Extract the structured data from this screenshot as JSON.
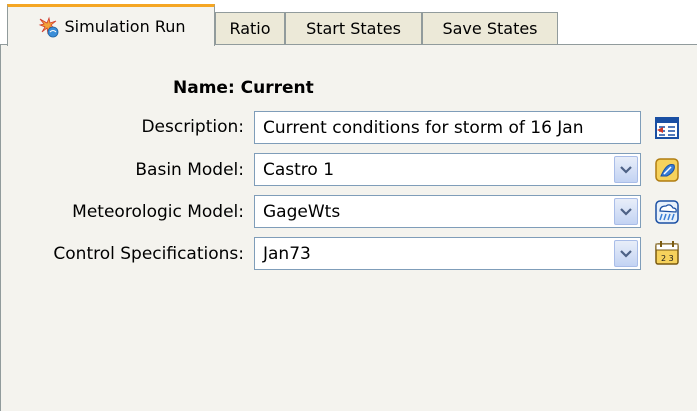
{
  "tabs": [
    {
      "label": "Simulation Run",
      "icon": "simulation-run-icon",
      "active": true
    },
    {
      "label": "Ratio"
    },
    {
      "label": "Start States"
    },
    {
      "label": "Save States"
    }
  ],
  "form": {
    "name_label": "Name: Current",
    "description_label": "Description:",
    "description_value": "Current conditions for storm of 16 Jan",
    "basin_label": "Basin Model:",
    "basin_value": "Castro 1",
    "met_label": "Meteorologic Model:",
    "met_value": "GageWts",
    "control_label": "Control Specifications:",
    "control_value": "Jan73"
  },
  "colors": {
    "panel": "#f4f3ee",
    "tab": "#ece9d8",
    "active_tab_accent": "#f5a623",
    "field_border": "#7f9db9"
  }
}
